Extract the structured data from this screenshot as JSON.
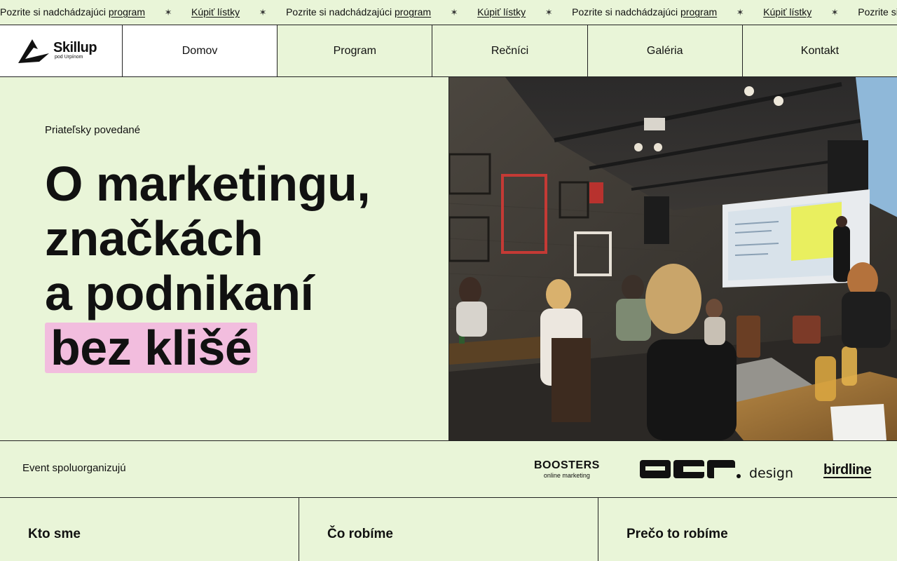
{
  "ticker": {
    "items": [
      {
        "text": "Pozrite si nadchádzajúci ",
        "link": "program"
      },
      {
        "text": "",
        "link": "Kúpiť lístky"
      },
      {
        "text": "Pozrite si nadchádzajúci ",
        "link": "program"
      },
      {
        "text": "",
        "link": "Kúpiť lístky"
      },
      {
        "text": "Pozrite si nadchádzajúci ",
        "link": "program"
      },
      {
        "text": "",
        "link": "Kúpiť lístky"
      },
      {
        "text": "Pozrite si n",
        "link": ""
      }
    ],
    "separator": "✶"
  },
  "logo": {
    "name": "Skillup",
    "tagline": "pod Urpínom"
  },
  "nav": {
    "items": [
      "Domov",
      "Program",
      "Rečníci",
      "Galéria",
      "Kontakt"
    ],
    "active": "Domov"
  },
  "hero": {
    "eyebrow": "Priateľsky povedané",
    "headline_lines": [
      "O marketingu,",
      "značkách",
      "a podnikaní"
    ],
    "highlight": "bez klišé",
    "highlight_color": "#f2bdde"
  },
  "sponsors": {
    "label": "Event spoluorganizujú",
    "boosters": {
      "name": "BOOSTERS",
      "sub": "online marketing"
    },
    "acr": {
      "name": "design"
    },
    "birdline": {
      "name": "birdline"
    }
  },
  "cards": [
    "Kto sme",
    "Čo robíme",
    "Prečo to robíme"
  ],
  "colors": {
    "background": "#e9f5d8",
    "accent": "#f2bdde",
    "text": "#111111"
  }
}
